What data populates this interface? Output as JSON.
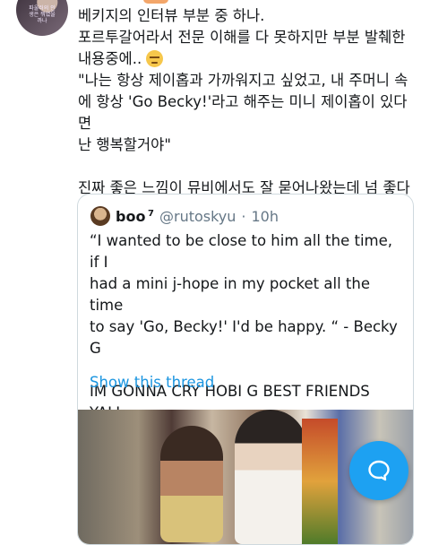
{
  "author_avatar": {
    "caption": "파울러의 인생은 뭐였을까나"
  },
  "tweet": {
    "text": "베키지의 인터뷰 부분 중 하나.\n포르투갈어라서 전문 이해를 다 못하지만 부분 발췌한\n내용중에..",
    "text2": "\"나는 항상 제이홉과 가까워지고 싶었고, 내 주머니 속\n에 항상 'Go Becky!'라고 해주는 미니 제이홉이 있다면\n난 행복할거야\"\n\n진짜 좋은 느낌이 뮤비에서도 잘 묻어나왔는데 넘 좋다\nㅠㅠ",
    "emoji": "relieved-face-emoji"
  },
  "quoted_tweet": {
    "name": "boo",
    "name_suffix": "7",
    "handle": "@rutoskyu",
    "separator": "·",
    "time": "10h",
    "text": "“I wanted to be close to him all the time, if I\nhad a mini j-hope in my pocket all the time\nto say 'Go, Becky!' I'd be happy. “ - Becky\nG\n\nIM GONNA CRY HOBI G BEST FRIENDS\nYALL",
    "show_thread_label": "Show this thread",
    "media": "photo"
  },
  "compose_button": {
    "icon": "compose-bubble-icon",
    "color": "#1da1f2"
  }
}
